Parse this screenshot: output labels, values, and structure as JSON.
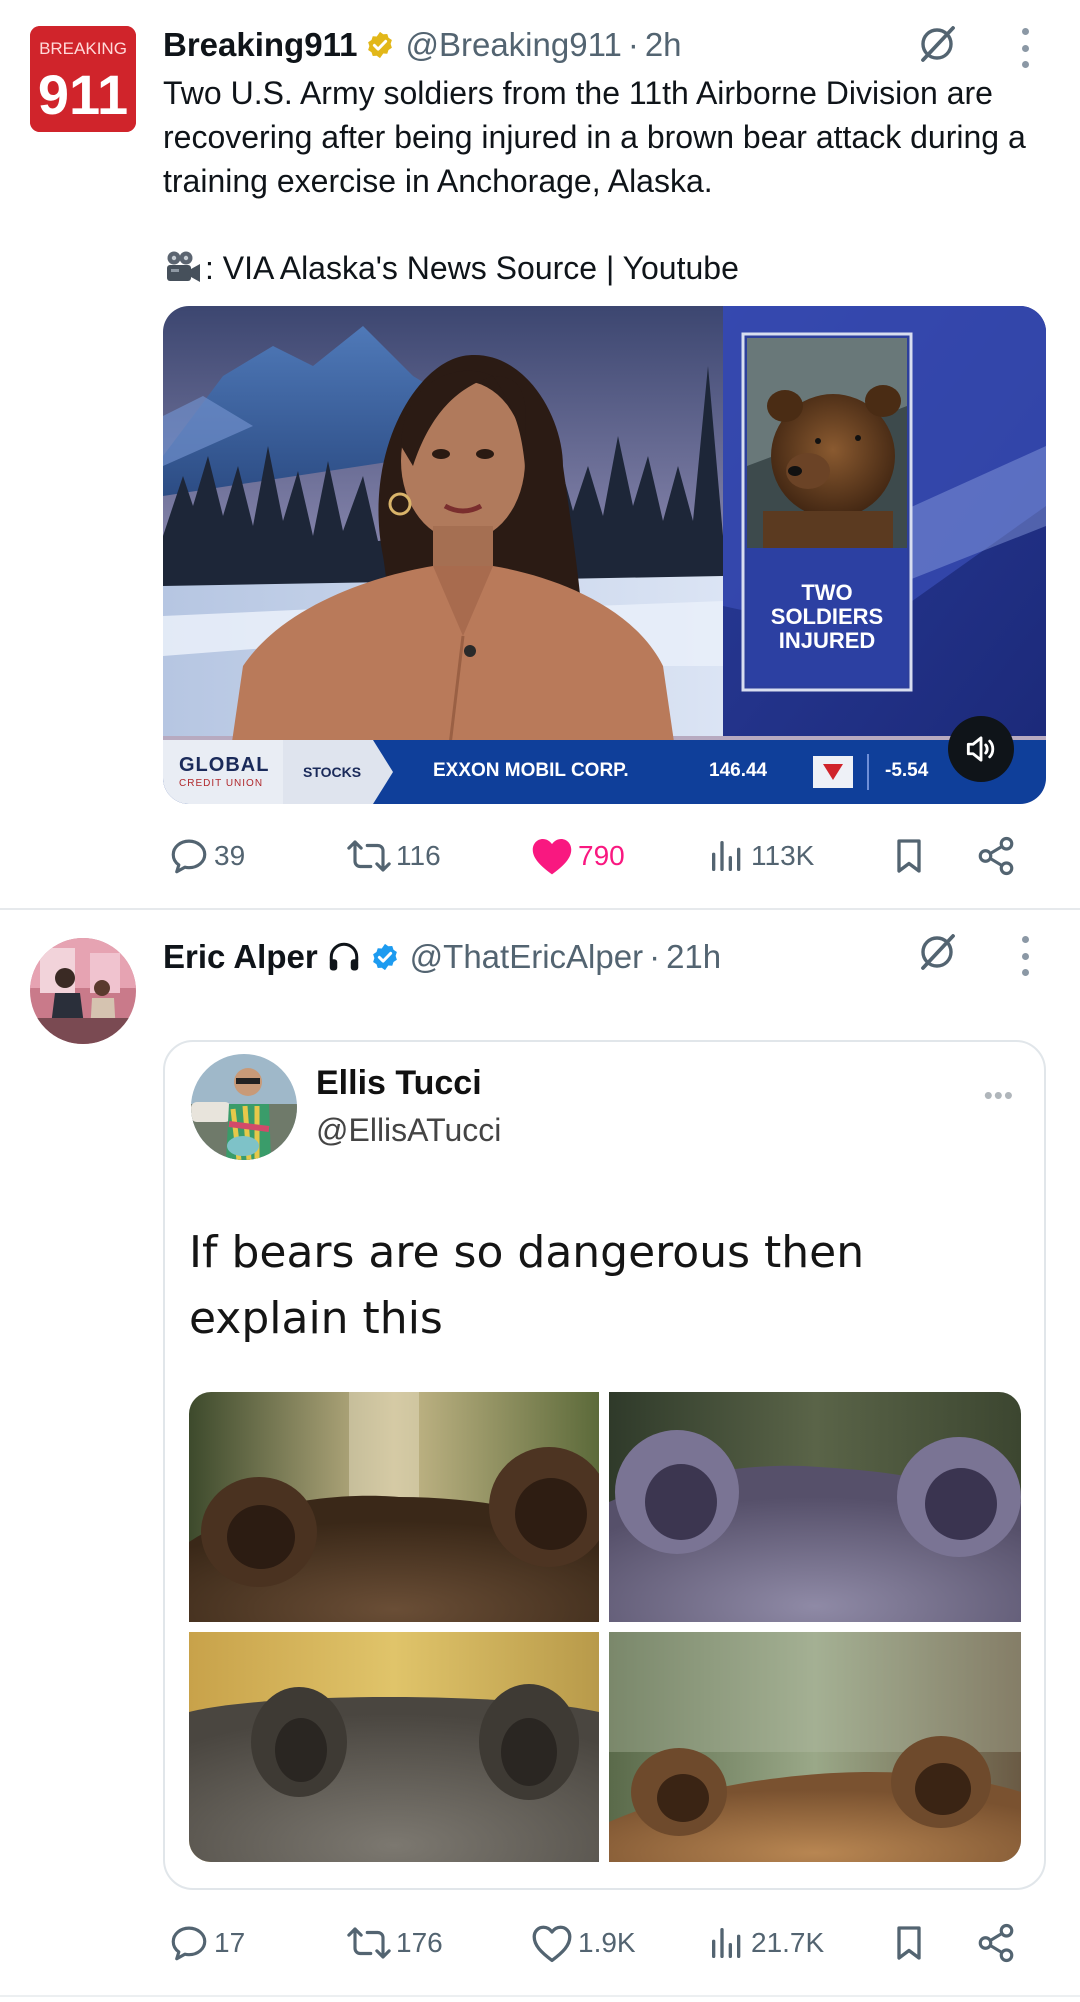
{
  "tweet1": {
    "avatar": {
      "top": "BREAKING",
      "bottom": "911"
    },
    "author_name": "Breaking911",
    "handle": "@Breaking911",
    "time": "2h",
    "body": "Two U.S. Army soldiers from the 11th Airborne Division are recovering after being injured in a brown bear attack during a training exercise in Anchorage, Alaska.",
    "source_line": ": VIA Alaska's News Source | Youtube",
    "video": {
      "graphic_text": "TWO SOLDIERS INJURED",
      "ticker_brand": "GLOBAL",
      "ticker_brand_sub": "CREDIT UNION",
      "ticker_tab": "STOCKS",
      "ticker_company": "EXXON MOBIL CORP.",
      "ticker_price": "146.44",
      "ticker_change": "-5.54"
    },
    "stats": {
      "replies": "39",
      "reposts": "116",
      "likes": "790",
      "views": "113K"
    }
  },
  "tweet2": {
    "author_name": "Eric Alper",
    "handle": "@ThatEricAlper",
    "time": "21h",
    "quote": {
      "author_name": "Ellis Tucci",
      "handle": "@EllisATucci",
      "more": "•••",
      "text": "If bears are so dangerous then explain this"
    },
    "stats": {
      "replies": "17",
      "reposts": "176",
      "likes": "1.9K",
      "views": "21.7K"
    }
  },
  "colors": {
    "like": "#f91880",
    "verified_blue": "#1d9bf0",
    "gold": "#e2b719",
    "brand_red": "#d0242b"
  }
}
